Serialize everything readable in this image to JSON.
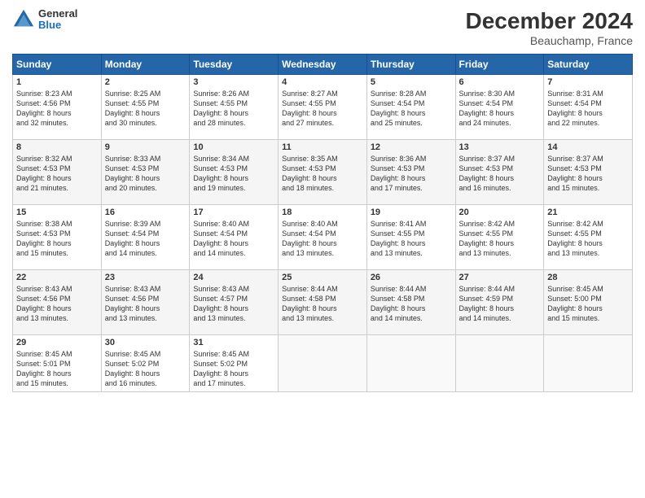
{
  "logo": {
    "general": "General",
    "blue": "Blue"
  },
  "header": {
    "month": "December 2024",
    "location": "Beauchamp, France"
  },
  "days": [
    "Sunday",
    "Monday",
    "Tuesday",
    "Wednesday",
    "Thursday",
    "Friday",
    "Saturday"
  ],
  "weeks": [
    [
      {
        "day": "1",
        "text": "Sunrise: 8:23 AM\nSunset: 4:56 PM\nDaylight: 8 hours\nand 32 minutes."
      },
      {
        "day": "2",
        "text": "Sunrise: 8:25 AM\nSunset: 4:55 PM\nDaylight: 8 hours\nand 30 minutes."
      },
      {
        "day": "3",
        "text": "Sunrise: 8:26 AM\nSunset: 4:55 PM\nDaylight: 8 hours\nand 28 minutes."
      },
      {
        "day": "4",
        "text": "Sunrise: 8:27 AM\nSunset: 4:55 PM\nDaylight: 8 hours\nand 27 minutes."
      },
      {
        "day": "5",
        "text": "Sunrise: 8:28 AM\nSunset: 4:54 PM\nDaylight: 8 hours\nand 25 minutes."
      },
      {
        "day": "6",
        "text": "Sunrise: 8:30 AM\nSunset: 4:54 PM\nDaylight: 8 hours\nand 24 minutes."
      },
      {
        "day": "7",
        "text": "Sunrise: 8:31 AM\nSunset: 4:54 PM\nDaylight: 8 hours\nand 22 minutes."
      }
    ],
    [
      {
        "day": "8",
        "text": "Sunrise: 8:32 AM\nSunset: 4:53 PM\nDaylight: 8 hours\nand 21 minutes."
      },
      {
        "day": "9",
        "text": "Sunrise: 8:33 AM\nSunset: 4:53 PM\nDaylight: 8 hours\nand 20 minutes."
      },
      {
        "day": "10",
        "text": "Sunrise: 8:34 AM\nSunset: 4:53 PM\nDaylight: 8 hours\nand 19 minutes."
      },
      {
        "day": "11",
        "text": "Sunrise: 8:35 AM\nSunset: 4:53 PM\nDaylight: 8 hours\nand 18 minutes."
      },
      {
        "day": "12",
        "text": "Sunrise: 8:36 AM\nSunset: 4:53 PM\nDaylight: 8 hours\nand 17 minutes."
      },
      {
        "day": "13",
        "text": "Sunrise: 8:37 AM\nSunset: 4:53 PM\nDaylight: 8 hours\nand 16 minutes."
      },
      {
        "day": "14",
        "text": "Sunrise: 8:37 AM\nSunset: 4:53 PM\nDaylight: 8 hours\nand 15 minutes."
      }
    ],
    [
      {
        "day": "15",
        "text": "Sunrise: 8:38 AM\nSunset: 4:53 PM\nDaylight: 8 hours\nand 15 minutes."
      },
      {
        "day": "16",
        "text": "Sunrise: 8:39 AM\nSunset: 4:54 PM\nDaylight: 8 hours\nand 14 minutes."
      },
      {
        "day": "17",
        "text": "Sunrise: 8:40 AM\nSunset: 4:54 PM\nDaylight: 8 hours\nand 14 minutes."
      },
      {
        "day": "18",
        "text": "Sunrise: 8:40 AM\nSunset: 4:54 PM\nDaylight: 8 hours\nand 13 minutes."
      },
      {
        "day": "19",
        "text": "Sunrise: 8:41 AM\nSunset: 4:55 PM\nDaylight: 8 hours\nand 13 minutes."
      },
      {
        "day": "20",
        "text": "Sunrise: 8:42 AM\nSunset: 4:55 PM\nDaylight: 8 hours\nand 13 minutes."
      },
      {
        "day": "21",
        "text": "Sunrise: 8:42 AM\nSunset: 4:55 PM\nDaylight: 8 hours\nand 13 minutes."
      }
    ],
    [
      {
        "day": "22",
        "text": "Sunrise: 8:43 AM\nSunset: 4:56 PM\nDaylight: 8 hours\nand 13 minutes."
      },
      {
        "day": "23",
        "text": "Sunrise: 8:43 AM\nSunset: 4:56 PM\nDaylight: 8 hours\nand 13 minutes."
      },
      {
        "day": "24",
        "text": "Sunrise: 8:43 AM\nSunset: 4:57 PM\nDaylight: 8 hours\nand 13 minutes."
      },
      {
        "day": "25",
        "text": "Sunrise: 8:44 AM\nSunset: 4:58 PM\nDaylight: 8 hours\nand 13 minutes."
      },
      {
        "day": "26",
        "text": "Sunrise: 8:44 AM\nSunset: 4:58 PM\nDaylight: 8 hours\nand 14 minutes."
      },
      {
        "day": "27",
        "text": "Sunrise: 8:44 AM\nSunset: 4:59 PM\nDaylight: 8 hours\nand 14 minutes."
      },
      {
        "day": "28",
        "text": "Sunrise: 8:45 AM\nSunset: 5:00 PM\nDaylight: 8 hours\nand 15 minutes."
      }
    ],
    [
      {
        "day": "29",
        "text": "Sunrise: 8:45 AM\nSunset: 5:01 PM\nDaylight: 8 hours\nand 15 minutes."
      },
      {
        "day": "30",
        "text": "Sunrise: 8:45 AM\nSunset: 5:02 PM\nDaylight: 8 hours\nand 16 minutes."
      },
      {
        "day": "31",
        "text": "Sunrise: 8:45 AM\nSunset: 5:02 PM\nDaylight: 8 hours\nand 17 minutes."
      },
      null,
      null,
      null,
      null
    ]
  ]
}
